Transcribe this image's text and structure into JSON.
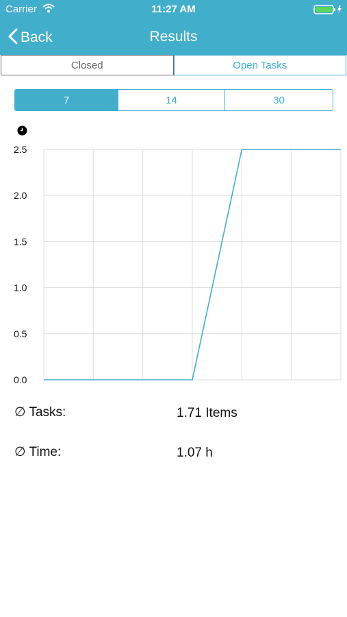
{
  "status_bar": {
    "carrier": "Carrier",
    "time": "11:27 AM"
  },
  "nav": {
    "back_label": "Back",
    "title": "Results"
  },
  "main_tabs": [
    {
      "label": "Closed",
      "selected": false
    },
    {
      "label": "Open Tasks",
      "selected": true
    }
  ],
  "range_tabs": [
    {
      "label": "7",
      "selected": true
    },
    {
      "label": "14",
      "selected": false
    },
    {
      "label": "30",
      "selected": false
    }
  ],
  "icons": {
    "clock": "clock-icon"
  },
  "colors": {
    "accent": "#41aecb"
  },
  "chart_data": {
    "type": "line",
    "series": [
      {
        "values": [
          0.0,
          0.0,
          0.0,
          0.0,
          2.5,
          2.5,
          2.5
        ]
      }
    ],
    "ylim": [
      0,
      2.5
    ],
    "y_ticks": [
      "0.0",
      "0.5",
      "1.0",
      "1.5",
      "2.0",
      "2.5"
    ],
    "grid": true
  },
  "stats": {
    "tasks_label": "∅ Tasks:",
    "tasks_value": "1.71 Items",
    "time_label": "∅ Time:",
    "time_value": "1.07 h"
  }
}
